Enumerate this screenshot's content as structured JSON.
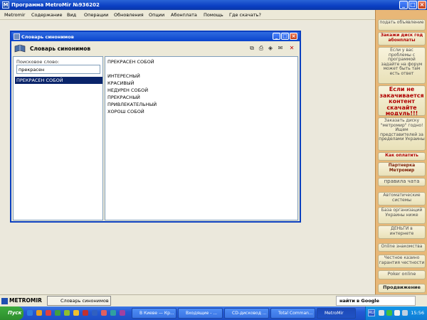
{
  "app": {
    "title": "Программа MetroMir №936202"
  },
  "menubar": [
    "Metromir",
    "Содержание",
    "Вид",
    "Операции",
    "Обновления",
    "Опции",
    "Абонплата",
    "Помощь",
    "Где скачать?"
  ],
  "dialog": {
    "title": "Словарь синонимов",
    "header": "Словарь синонимов",
    "search_label": "Поисковое слово:",
    "search_value": "прекрасен",
    "results": [
      "ПРЕКРАСЕН СОБОЙ"
    ],
    "headword": "ПРЕКРАСЕН СОБОЙ",
    "synonyms": [
      "ИНТЕРЕСНЫЙ",
      "КРАСИВЫЙ",
      "НЕДУРЕН СОБОЙ",
      "ПРЕКРАСНЫЙ",
      "ПРИВЛЕКАТЕЛЬНЫЙ",
      "ХОРОШ СОБОЙ"
    ]
  },
  "ads": [
    "подать объявление",
    "Закажи диск год абонплаты",
    "Если у вас проблемы с программой задайте на форум может быть там есть ответ",
    "Если не закачивается контент скачайте модуль!!!",
    "Заказать диску \"метромир\" годно! Ищем представителей за пределами Украины",
    "Как оплатить",
    "Партнерка Метромир",
    "правила чата",
    "Автоматические системы",
    "База организаций Украины ниже",
    "ДЕНЬГИ в интернете",
    "Online знакомства",
    "Честное казино гарантия честности",
    "Poker online",
    "Продвижение"
  ],
  "statusbar": {
    "logo": "METROMIR",
    "tab": "Словарь синонимов",
    "google": "найти в Google"
  },
  "taskbar": {
    "start": "Пуск",
    "tasks": [
      "В Киеве — Кр...",
      "Входящие - ...",
      "CD-дисковод ...",
      "Total Comman...",
      "MetroMir"
    ],
    "lang": "RU",
    "clock": "15:56"
  }
}
